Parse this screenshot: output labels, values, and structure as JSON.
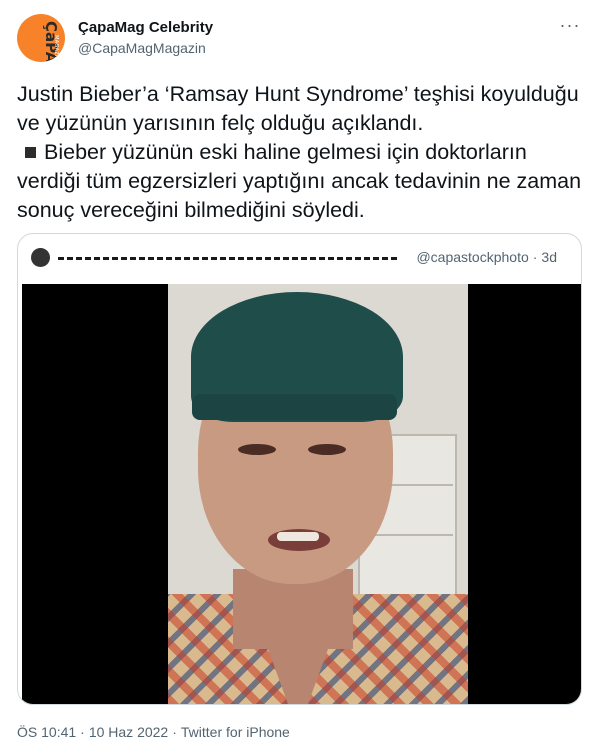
{
  "author": {
    "display_name": "ÇapaMag Celebrity",
    "handle": "@CapaMagMagazin",
    "avatar_logo_text": "ÇaPA",
    "avatar_logo_subtext": "MAGAZIN",
    "avatar_color": "#f7822a"
  },
  "more_icon": "more-horizontal-icon",
  "tweet": {
    "line1": "Justin Bieber’a ‘Ramsay Hunt Syndrome’ teşhisi koyulduğu ve yüzünün yarısının felç olduğu açıklandı.",
    "line2": "Bieber yüzünün eski haline gelmesi için doktorların verdiği tüm egzersizleri yaptığını ancak tedavinin ne zaman sonuç vereceğini bilmediğini söyledi."
  },
  "quote": {
    "handle": "@capastockphoto",
    "time": "3d",
    "dot": "·",
    "media_icon": "video-still-image"
  },
  "footer": {
    "time": "ÖS 10:41",
    "date": "10 Haz 2022",
    "source": "Twitter for iPhone",
    "dot": "·"
  },
  "colors": {
    "text": "#0f1419",
    "secondary": "#536471",
    "border": "#cfd9de"
  }
}
